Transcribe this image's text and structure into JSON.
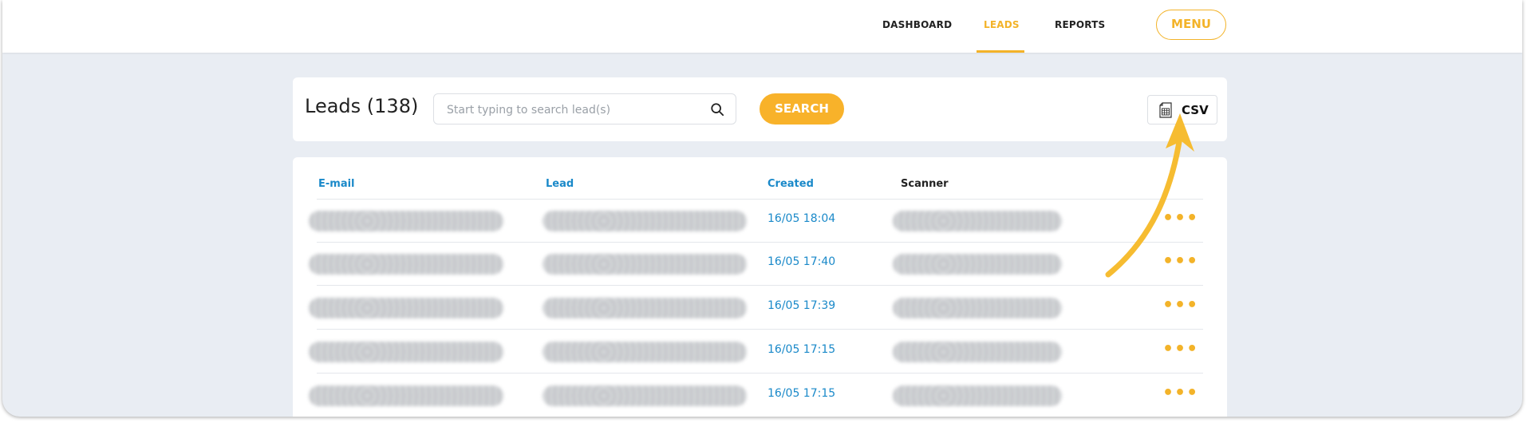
{
  "nav": {
    "dashboard": "DASHBOARD",
    "leads": "LEADS",
    "reports": "REPORTS",
    "menu": "MENU"
  },
  "header": {
    "title": "Leads (138)",
    "search_placeholder": "Start typing to search lead(s)",
    "search_value": "",
    "search_button": "SEARCH",
    "csv_button": "CSV"
  },
  "table": {
    "columns": [
      "E-mail",
      "Lead",
      "Created",
      "Scanner"
    ],
    "rows": [
      {
        "created": "16/05 18:04",
        "actions": "•••"
      },
      {
        "created": "16/05 17:40",
        "actions": "•••"
      },
      {
        "created": "16/05 17:39",
        "actions": "•••"
      },
      {
        "created": "16/05 17:15",
        "actions": "•••"
      },
      {
        "created": "16/05 17:15",
        "actions": "•••"
      }
    ]
  },
  "colors": {
    "accent": "#f3b329",
    "link": "#1a89c9",
    "background": "#e9edf3"
  },
  "icons": [
    "search-icon",
    "csv-file-icon",
    "more-dots-icon",
    "annotation-arrow"
  ]
}
